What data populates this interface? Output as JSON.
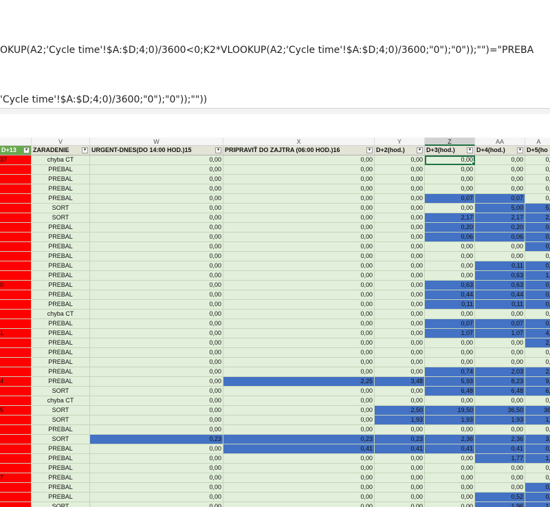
{
  "formula_bar": {
    "line1": "OKUP(A2;'Cycle time'!$A:$D;4;0)/3600<0;K2*VLOOKUP(A2;'Cycle time'!$A:$D;4;0)/3600;\"0\");\"0\"));\"\")=\"PREBA",
    "line2": "'Cycle time'!$A:$D;4;0)/3600;\"0\");\"0\"));\"\"))"
  },
  "columns": [
    {
      "letter": "",
      "header": "D+13"
    },
    {
      "letter": "V",
      "header": "ZARADENIE"
    },
    {
      "letter": "W",
      "header": "URGENT-DNES(DO 14:00 HOD.)15"
    },
    {
      "letter": "X",
      "header": "PRIPRAVIŤ DO ZAJTRA (06:00 HOD.)16"
    },
    {
      "letter": "Y",
      "header": "D+2(hod.)"
    },
    {
      "letter": "Z",
      "header": "D+3(hod.)"
    },
    {
      "letter": "AA",
      "header": "D+4(hod.)"
    },
    {
      "letter": "A",
      "header": "D+5(ho"
    }
  ],
  "filter_glyph": "▾",
  "rows": [
    {
      "a": "37",
      "v": "chyba CT",
      "w": "0,00",
      "x": "0,00",
      "y": "0,00",
      "z": "0,00",
      "aa": "0,00",
      "ab": "0,"
    },
    {
      "a": "",
      "v": "PREBAL",
      "w": "0,00",
      "x": "0,00",
      "y": "0,00",
      "z": "0,00",
      "aa": "0,00",
      "ab": "0,"
    },
    {
      "a": "",
      "v": "PREBAL",
      "w": "0,00",
      "x": "0,00",
      "y": "0,00",
      "z": "0,00",
      "aa": "0,00",
      "ab": "0,"
    },
    {
      "a": "",
      "v": "PREBAL",
      "w": "0,00",
      "x": "0,00",
      "y": "0,00",
      "z": "0,00",
      "aa": "0,00",
      "ab": "0,"
    },
    {
      "a": "",
      "v": "PREBAL",
      "w": "0,00",
      "x": "0,00",
      "y": "0,00",
      "z": "0,07",
      "aa": "0,07",
      "ab": "0,"
    },
    {
      "a": "",
      "v": "SORT",
      "w": "0,00",
      "x": "0,00",
      "y": "0,00",
      "z": "0,00",
      "aa": "5,00",
      "ab": "5,"
    },
    {
      "a": "",
      "v": "SORT",
      "w": "0,00",
      "x": "0,00",
      "y": "0,00",
      "z": "2,17",
      "aa": "2,17",
      "ab": "2,"
    },
    {
      "a": "",
      "v": "PREBAL",
      "w": "0,00",
      "x": "0,00",
      "y": "0,00",
      "z": "0,20",
      "aa": "0,20",
      "ab": "0,"
    },
    {
      "a": "",
      "v": "PREBAL",
      "w": "0,00",
      "x": "0,00",
      "y": "0,00",
      "z": "0,06",
      "aa": "0,06",
      "ab": "0,"
    },
    {
      "a": "",
      "v": "PREBAL",
      "w": "0,00",
      "x": "0,00",
      "y": "0,00",
      "z": "0,00",
      "aa": "0,00",
      "ab": "0,"
    },
    {
      "a": "",
      "v": "PREBAL",
      "w": "0,00",
      "x": "0,00",
      "y": "0,00",
      "z": "0,00",
      "aa": "0,00",
      "ab": "0,"
    },
    {
      "a": "",
      "v": "PREBAL",
      "w": "0,00",
      "x": "0,00",
      "y": "0,00",
      "z": "0,00",
      "aa": "0,11",
      "ab": "0,"
    },
    {
      "a": "",
      "v": "PREBAL",
      "w": "0,00",
      "x": "0,00",
      "y": "0,00",
      "z": "0,00",
      "aa": "0,63",
      "ab": "1,"
    },
    {
      "a": "0",
      "v": "PREBAL",
      "w": "0,00",
      "x": "0,00",
      "y": "0,00",
      "z": "0,63",
      "aa": "0,63",
      "ab": "0,"
    },
    {
      "a": "",
      "v": "PREBAL",
      "w": "0,00",
      "x": "0,00",
      "y": "0,00",
      "z": "0,44",
      "aa": "0,44",
      "ab": "0,"
    },
    {
      "a": "",
      "v": "PREBAL",
      "w": "0,00",
      "x": "0,00",
      "y": "0,00",
      "z": "0,11",
      "aa": "0,11",
      "ab": "0,"
    },
    {
      "a": "",
      "v": "chyba CT",
      "w": "0,00",
      "x": "0,00",
      "y": "0,00",
      "z": "0,00",
      "aa": "0,00",
      "ab": "0,"
    },
    {
      "a": "",
      "v": "PREBAL",
      "w": "0,00",
      "x": "0,00",
      "y": "0,00",
      "z": "0,07",
      "aa": "0,07",
      "ab": "0,"
    },
    {
      "a": "1",
      "v": "PREBAL",
      "w": "0,00",
      "x": "0,00",
      "y": "0,00",
      "z": "1,07",
      "aa": "1,07",
      "ab": "4,"
    },
    {
      "a": "",
      "v": "PREBAL",
      "w": "0,00",
      "x": "0,00",
      "y": "0,00",
      "z": "0,00",
      "aa": "0,00",
      "ab": "2,"
    },
    {
      "a": "",
      "v": "PREBAL",
      "w": "0,00",
      "x": "0,00",
      "y": "0,00",
      "z": "0,00",
      "aa": "0,00",
      "ab": "0,"
    },
    {
      "a": "",
      "v": "PREBAL",
      "w": "0,00",
      "x": "0,00",
      "y": "0,00",
      "z": "0,00",
      "aa": "0,00",
      "ab": "0,"
    },
    {
      "a": "",
      "v": "PREBAL",
      "w": "0,00",
      "x": "0,00",
      "y": "0,00",
      "z": "0,74",
      "aa": "2,03",
      "ab": "2,"
    },
    {
      "a": "4",
      "v": "PREBAL",
      "w": "0,00",
      "x": "2,25",
      "y": "3,48",
      "z": "5,93",
      "aa": "8,23",
      "ab": "9,"
    },
    {
      "a": "",
      "v": "SORT",
      "w": "0,00",
      "x": "0,00",
      "y": "0,00",
      "z": "6,48",
      "aa": "6,48",
      "ab": "6,"
    },
    {
      "a": "",
      "v": "chyba CT",
      "w": "0,00",
      "x": "0,00",
      "y": "0,00",
      "z": "0,00",
      "aa": "0,00",
      "ab": "0,"
    },
    {
      "a": "5",
      "v": "SORT",
      "w": "0,00",
      "x": "0,00",
      "y": "2,50",
      "z": "19,50",
      "aa": "36,50",
      "ab": "36"
    },
    {
      "a": "",
      "v": "SORT",
      "w": "0,00",
      "x": "0,00",
      "y": "1,93",
      "z": "1,93",
      "aa": "1,93",
      "ab": "1,"
    },
    {
      "a": "",
      "v": "PREBAL",
      "w": "0,00",
      "x": "0,00",
      "y": "0,00",
      "z": "0,00",
      "aa": "0,00",
      "ab": "0,"
    },
    {
      "a": "",
      "v": "SORT",
      "w": "0,23",
      "x": "0,23",
      "y": "0,23",
      "z": "2,36",
      "aa": "2,36",
      "ab": "3,"
    },
    {
      "a": "",
      "v": "PREBAL",
      "w": "0,00",
      "x": "0,41",
      "y": "0,41",
      "z": "0,41",
      "aa": "0,41",
      "ab": "0,"
    },
    {
      "a": "",
      "v": "PREBAL",
      "w": "0,00",
      "x": "0,00",
      "y": "0,00",
      "z": "0,00",
      "aa": "1,77",
      "ab": "1,"
    },
    {
      "a": "",
      "v": "PREBAL",
      "w": "0,00",
      "x": "0,00",
      "y": "0,00",
      "z": "0,00",
      "aa": "0,00",
      "ab": "0,"
    },
    {
      "a": "7",
      "v": "PREBAL",
      "w": "0,00",
      "x": "0,00",
      "y": "0,00",
      "z": "0,00",
      "aa": "0,00",
      "ab": "0,"
    },
    {
      "a": "",
      "v": "PREBAL",
      "w": "0,00",
      "x": "0,00",
      "y": "0,00",
      "z": "0,00",
      "aa": "0,00",
      "ab": "0,"
    },
    {
      "a": "",
      "v": "PREBAL",
      "w": "0,00",
      "x": "0,00",
      "y": "0,00",
      "z": "0,00",
      "aa": "0,52",
      "ab": "0,"
    },
    {
      "a": "",
      "v": "SORT",
      "w": "0,00",
      "x": "0,00",
      "y": "0,00",
      "z": "0,00",
      "aa": "1,96",
      "ab": "1,"
    }
  ],
  "highlight": {
    "blue_cells": [
      [
        4,
        "z"
      ],
      [
        4,
        "aa"
      ],
      [
        5,
        "aa"
      ],
      [
        5,
        "ab"
      ],
      [
        6,
        "z"
      ],
      [
        6,
        "aa"
      ],
      [
        6,
        "ab"
      ],
      [
        7,
        "z"
      ],
      [
        7,
        "aa"
      ],
      [
        7,
        "ab"
      ],
      [
        8,
        "z"
      ],
      [
        8,
        "aa"
      ],
      [
        8,
        "ab"
      ],
      [
        9,
        "ab"
      ],
      [
        11,
        "aa"
      ],
      [
        11,
        "ab"
      ],
      [
        12,
        "aa"
      ],
      [
        12,
        "ab"
      ],
      [
        13,
        "z"
      ],
      [
        13,
        "aa"
      ],
      [
        13,
        "ab"
      ],
      [
        14,
        "z"
      ],
      [
        14,
        "aa"
      ],
      [
        14,
        "ab"
      ],
      [
        15,
        "z"
      ],
      [
        15,
        "aa"
      ],
      [
        15,
        "ab"
      ],
      [
        17,
        "z"
      ],
      [
        17,
        "aa"
      ],
      [
        17,
        "ab"
      ],
      [
        18,
        "z"
      ],
      [
        18,
        "aa"
      ],
      [
        18,
        "ab"
      ],
      [
        19,
        "ab"
      ],
      [
        22,
        "z"
      ],
      [
        22,
        "aa"
      ],
      [
        22,
        "ab"
      ],
      [
        23,
        "x"
      ],
      [
        23,
        "y"
      ],
      [
        23,
        "z"
      ],
      [
        23,
        "aa"
      ],
      [
        23,
        "ab"
      ],
      [
        24,
        "z"
      ],
      [
        24,
        "aa"
      ],
      [
        24,
        "ab"
      ],
      [
        26,
        "y"
      ],
      [
        26,
        "z"
      ],
      [
        26,
        "aa"
      ],
      [
        26,
        "ab"
      ],
      [
        27,
        "y"
      ],
      [
        27,
        "z"
      ],
      [
        27,
        "aa"
      ],
      [
        27,
        "ab"
      ],
      [
        29,
        "w"
      ],
      [
        29,
        "x"
      ],
      [
        29,
        "y"
      ],
      [
        29,
        "z"
      ],
      [
        29,
        "aa"
      ],
      [
        29,
        "ab"
      ],
      [
        30,
        "x"
      ],
      [
        30,
        "y"
      ],
      [
        30,
        "z"
      ],
      [
        30,
        "aa"
      ],
      [
        30,
        "ab"
      ],
      [
        31,
        "aa"
      ],
      [
        31,
        "ab"
      ],
      [
        34,
        "ab"
      ],
      [
        35,
        "aa"
      ],
      [
        35,
        "ab"
      ],
      [
        36,
        "aa"
      ],
      [
        36,
        "ab"
      ]
    ],
    "selected_cell": [
      0,
      "z"
    ],
    "selected_column": "Z"
  },
  "colors": {
    "cell_green": "#e2efda",
    "cell_blue": "#4472c4",
    "cell_red": "#ff0000",
    "header_green": "#6aa84f",
    "header_tan": "#e3e3d6",
    "selection_green": "#217346"
  }
}
